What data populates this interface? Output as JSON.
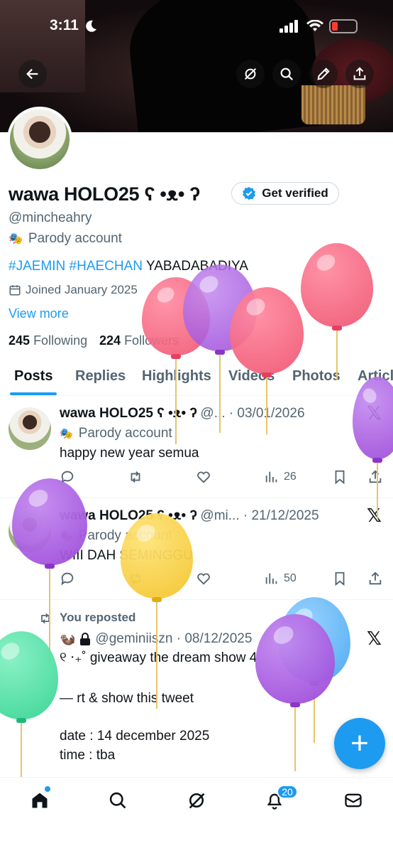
{
  "status_bar": {
    "time": "3:11",
    "moon_icon": "moon-icon",
    "signal_icon": "signal-icon",
    "wifi_icon": "wifi-icon",
    "battery_icon": "battery-low-icon"
  },
  "header": {
    "back_icon": "arrow-left-icon",
    "grok_icon": "grok-icon",
    "search_icon": "search-icon",
    "edit_icon": "pencil-icon",
    "share_icon": "share-icon"
  },
  "profile": {
    "name": "wawa HOLO25 ʕ •ᴥ• ʔ",
    "handle": "@mincheahry",
    "get_verified": "Get verified",
    "parody_label": "Parody account",
    "bio_tag1": "#JAEMIN",
    "bio_tag2": "#HAECHAN",
    "bio_text": "YABADABADIYA",
    "joined": "Joined January 2025",
    "view_more": "View more",
    "following_count": "245",
    "following_label": "Following",
    "followers_count": "224",
    "followers_label": "Followers"
  },
  "tabs": [
    "Posts",
    "Replies",
    "Highlights",
    "Videos",
    "Photos",
    "Articles"
  ],
  "posts": [
    {
      "name": "wawa HOLO25 ʕ •ᴥ• ʔ",
      "meta": "@... · 03/01/2026",
      "badge": "Parody account",
      "text": "happy new year semua",
      "views": "26"
    },
    {
      "name": "wawa HOLO25 ʕ •ᴥ• ʔ",
      "meta": "@mi... · 21/12/2025",
      "badge": "Parody account",
      "text": "WIII DAH SEMINGGU",
      "views": "50"
    }
  ],
  "repost": {
    "label": "You reposted",
    "handle": "@geminiiszn · 08/12/2025",
    "line1": "୧ ‧₊˚ giveaway the dream show 4",
    "line2": "— rt & show this tweet",
    "line3": "date : 14 december 2025",
    "line4": "time : tba"
  },
  "colors": {
    "accent": "#1d9bf0",
    "text": "#0f1419",
    "muted": "#536471"
  },
  "nav": {
    "home_icon": "home-icon",
    "search_icon": "search-icon",
    "grok_icon": "grok-icon",
    "notifications_icon": "bell-icon",
    "notifications_badge": "20",
    "messages_icon": "mail-icon"
  },
  "fab": {
    "label": "+"
  }
}
